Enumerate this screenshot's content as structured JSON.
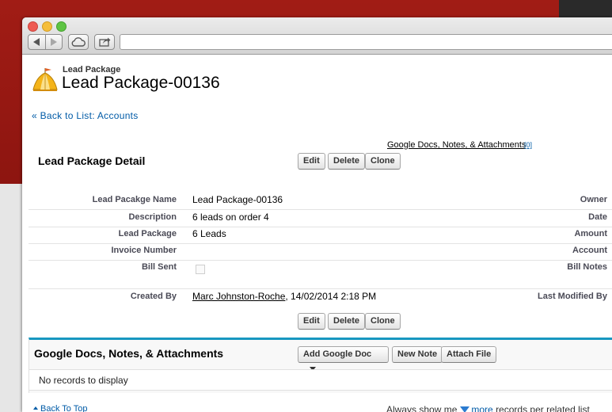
{
  "colors": {
    "desktop_red": "#9b1a14",
    "link_blue": "#015ba7",
    "panel_accent": "#1797c0"
  },
  "browser": {
    "url": ""
  },
  "header": {
    "object_type": "Lead Package",
    "record_title": "Lead Package-00136",
    "logo_icon": "tent-icon"
  },
  "back_link": "« Back to List: Accounts",
  "related_links": {
    "label": "Google Docs, Notes, & Attachments",
    "count": "[0]"
  },
  "detail": {
    "title": "Lead Package Detail",
    "buttons": {
      "edit": "Edit",
      "delete": "Delete",
      "clone": "Clone"
    },
    "fields": {
      "name_label": "Lead Pacakge Name",
      "name_value": "Lead Package-00136",
      "description_label": "Description",
      "description_value": "6 leads on order 4",
      "lead_package_label": "Lead Package",
      "lead_package_value": "6 Leads",
      "invoice_label": "Invoice Number",
      "invoice_value": "",
      "bill_sent_label": "Bill Sent",
      "created_by_label": "Created By",
      "created_by_user": "Marc Johnston-Roche",
      "created_by_date": ", 14/02/2014 2:18 PM"
    },
    "right_labels": {
      "owner": "Owner",
      "date": "Date",
      "amount": "Amount",
      "account": "Account",
      "bill_notes": "Bill Notes",
      "last_modified": "Last Modified By"
    }
  },
  "related_panel": {
    "title": "Google Docs, Notes, & Attachments",
    "add_google_doc": "Add Google Doc",
    "new_note": "New Note",
    "attach_file": "Attach File",
    "empty_text": "No records to display"
  },
  "footer": {
    "back_to_top": "Back To Top",
    "always_show": "Always show me",
    "more": "more",
    "per_list": "records per related list"
  }
}
